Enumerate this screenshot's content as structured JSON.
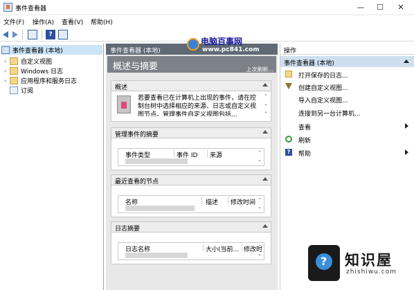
{
  "window": {
    "title": "事件查看器",
    "buttons": {
      "minimize": "—",
      "maximize": "☐",
      "close": "✕"
    }
  },
  "menu": [
    "文件(F)",
    "操作(A)",
    "查看(V)",
    "帮助(H)"
  ],
  "tree": {
    "root": "事件查看器 (本地)",
    "items": [
      "自定义视图",
      "Windows 日志",
      "应用程序和服务日志",
      "订阅"
    ]
  },
  "center": {
    "header": "事件查看器 (本地)",
    "banner_title": "概述与摘要",
    "banner_refresh": "上次刷新...",
    "watermark": {
      "name": "电脑百事网",
      "url": "www.pc841.com"
    },
    "panels": {
      "overview": {
        "title": "概述",
        "text": "若要查看已在计算机上出现的事件，请在控制台树中选择相应的来源、日志或自定义视图节点。管理事件自定义视图包括..."
      },
      "admin_events": {
        "title": "管理事件的摘要",
        "columns": [
          "事件类型",
          "事件 ID",
          "来源"
        ]
      },
      "recent": {
        "title": "最近查看的节点",
        "columns": [
          "名称",
          "描述",
          "修改时间"
        ]
      },
      "log_summary": {
        "title": "日志摘要",
        "columns": [
          "日志名称",
          "大小(当前...",
          "修改时"
        ]
      }
    }
  },
  "actions": {
    "header": "操作",
    "section": "事件查看器 (本地)",
    "items": [
      {
        "label": "打开保存的日志...",
        "icon": "open-folder-icon"
      },
      {
        "label": "创建自定义视图...",
        "icon": "filter-icon"
      },
      {
        "label": "导入自定义视图...",
        "icon": ""
      },
      {
        "label": "连接到另一台计算机...",
        "icon": ""
      },
      {
        "label": "查看",
        "icon": ""
      },
      {
        "label": "刷新",
        "icon": "refresh-icon"
      },
      {
        "label": "帮助",
        "icon": "help-icon"
      }
    ]
  },
  "logo_watermark": {
    "brand": "知识屋",
    "domain": "zhishiwu.com"
  }
}
